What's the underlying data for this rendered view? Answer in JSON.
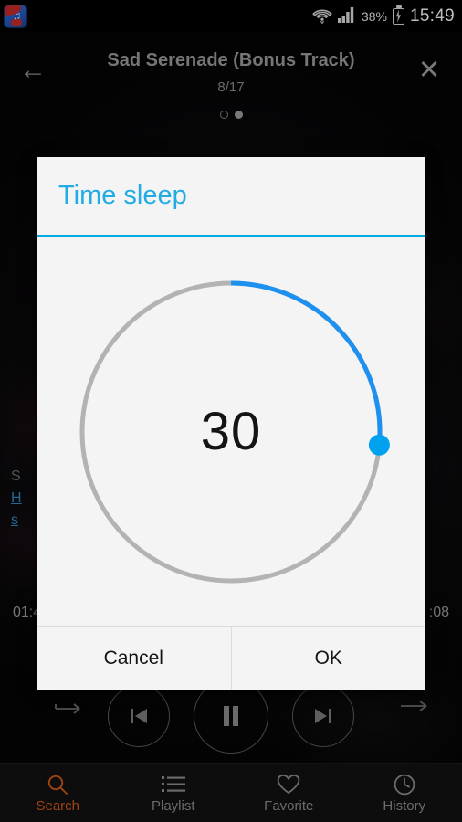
{
  "statusbar": {
    "app_icon": "music-app-notification-icon",
    "wifi_icon": "wifi-icon",
    "signal_icon": "cellular-signal-icon",
    "battery_percent": "38%",
    "battery_icon": "battery-charging-icon",
    "time": "15:49"
  },
  "header": {
    "back_icon": "back-arrow-icon",
    "close_icon": "close-icon",
    "title": "Sad Serenade (Bonus Track)",
    "index": "8/17",
    "dots": [
      "page-dot-1",
      "page-dot-2"
    ]
  },
  "background": {
    "song_line1": "S",
    "song_link1": "H",
    "song_link2": "s",
    "time_elapsed": "01:4",
    "time_total": ":08",
    "repeat_icon": "repeat-icon",
    "previous_icon": "previous-track-icon",
    "pause_icon": "pause-icon",
    "next_icon": "next-track-icon",
    "shuffle_icon": "shuffle-icon"
  },
  "dialog": {
    "title": "Time sleep",
    "value": "30",
    "min": 0,
    "max": 120,
    "arc_degrees": 95,
    "accent_color": "#00ace0",
    "arc_color": "#1e90f0",
    "track_color": "#b3b3b3",
    "cancel_label": "Cancel",
    "ok_label": "OK"
  },
  "bottomnav": {
    "items": [
      {
        "label": "Search",
        "icon": "search-icon",
        "active": true
      },
      {
        "label": "Playlist",
        "icon": "playlist-icon",
        "active": false
      },
      {
        "label": "Favorite",
        "icon": "heart-icon",
        "active": false
      },
      {
        "label": "History",
        "icon": "clock-icon",
        "active": false
      }
    ],
    "active_color": "#cc5418",
    "inactive_color": "#8b8b8b"
  }
}
